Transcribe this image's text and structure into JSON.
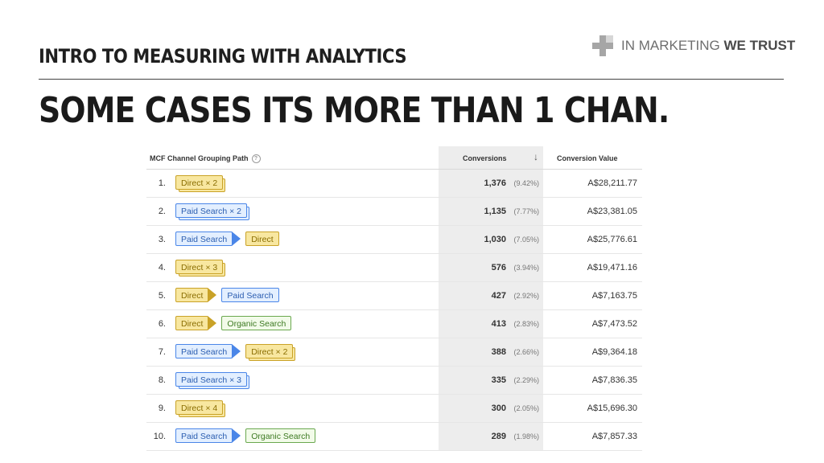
{
  "header": {
    "subtitle": "INTRO TO MEASURING WITH ANALYTICS",
    "headline": "SOME CASES ITS MORE THAN 1 CHAN.",
    "brand_light": "IN MARKETING ",
    "brand_bold": "WE TRUST"
  },
  "table": {
    "col_path": "MCF Channel Grouping Path",
    "col_conversions": "Conversions",
    "col_value": "Conversion Value",
    "sort_indicator": "↓",
    "rows": [
      {
        "num": "1.",
        "path": [
          {
            "label": "Direct × 2",
            "type": "direct",
            "stack": true
          }
        ],
        "conversions": "1,376",
        "pct": "(9.42%)",
        "value": "A$28,211.77"
      },
      {
        "num": "2.",
        "path": [
          {
            "label": "Paid Search × 2",
            "type": "paid",
            "stack": true
          }
        ],
        "conversions": "1,135",
        "pct": "(7.77%)",
        "value": "A$23,381.05"
      },
      {
        "num": "3.",
        "path": [
          {
            "label": "Paid Search",
            "type": "paid",
            "stack": false
          },
          {
            "label": "Direct",
            "type": "direct",
            "stack": false
          }
        ],
        "conversions": "1,030",
        "pct": "(7.05%)",
        "value": "A$25,776.61"
      },
      {
        "num": "4.",
        "path": [
          {
            "label": "Direct × 3",
            "type": "direct",
            "stack": true
          }
        ],
        "conversions": "576",
        "pct": "(3.94%)",
        "value": "A$19,471.16"
      },
      {
        "num": "5.",
        "path": [
          {
            "label": "Direct",
            "type": "direct",
            "stack": false
          },
          {
            "label": "Paid Search",
            "type": "paid",
            "stack": false
          }
        ],
        "conversions": "427",
        "pct": "(2.92%)",
        "value": "A$7,163.75"
      },
      {
        "num": "6.",
        "path": [
          {
            "label": "Direct",
            "type": "direct",
            "stack": false
          },
          {
            "label": "Organic Search",
            "type": "organic",
            "stack": false
          }
        ],
        "conversions": "413",
        "pct": "(2.83%)",
        "value": "A$7,473.52"
      },
      {
        "num": "7.",
        "path": [
          {
            "label": "Paid Search",
            "type": "paid",
            "stack": false
          },
          {
            "label": "Direct × 2",
            "type": "direct",
            "stack": true
          }
        ],
        "conversions": "388",
        "pct": "(2.66%)",
        "value": "A$9,364.18"
      },
      {
        "num": "8.",
        "path": [
          {
            "label": "Paid Search × 3",
            "type": "paid",
            "stack": true
          }
        ],
        "conversions": "335",
        "pct": "(2.29%)",
        "value": "A$7,836.35"
      },
      {
        "num": "9.",
        "path": [
          {
            "label": "Direct × 4",
            "type": "direct",
            "stack": true
          }
        ],
        "conversions": "300",
        "pct": "(2.05%)",
        "value": "A$15,696.30"
      },
      {
        "num": "10.",
        "path": [
          {
            "label": "Paid Search",
            "type": "paid",
            "stack": false
          },
          {
            "label": "Organic Search",
            "type": "organic",
            "stack": false
          }
        ],
        "conversions": "289",
        "pct": "(1.98%)",
        "value": "A$7,857.33"
      }
    ]
  },
  "colors": {
    "direct": "#f8e7a0",
    "paid_search": "#e3efff",
    "organic_search": "#f2fbe9"
  }
}
